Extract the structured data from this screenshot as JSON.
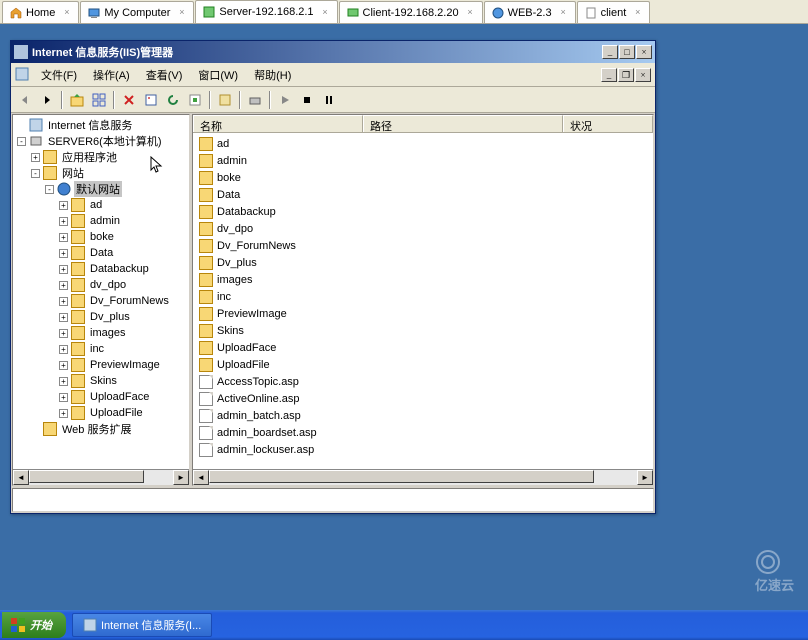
{
  "tabs": [
    {
      "label": "Home",
      "icon": "home"
    },
    {
      "label": "My Computer",
      "icon": "computer"
    },
    {
      "label": "Server-192.168.2.1",
      "icon": "server",
      "active": true
    },
    {
      "label": "Client-192.168.2.20",
      "icon": "client"
    },
    {
      "label": "WEB-2.3",
      "icon": "web"
    },
    {
      "label": "client",
      "icon": "doc"
    }
  ],
  "window": {
    "title": "Internet 信息服务(IIS)管理器",
    "menus": {
      "file": "文件(F)",
      "action": "操作(A)",
      "view": "查看(V)",
      "window": "窗口(W)",
      "help": "帮助(H)"
    }
  },
  "tree": {
    "root": "Internet 信息服务",
    "server": "SERVER6(本地计算机)",
    "apppool": "应用程序池",
    "sites": "网站",
    "defaultSite": "默认网站",
    "children": [
      "ad",
      "admin",
      "boke",
      "Data",
      "Databackup",
      "dv_dpo",
      "Dv_ForumNews",
      "Dv_plus",
      "images",
      "inc",
      "PreviewImage",
      "Skins",
      "UploadFace",
      "UploadFile"
    ],
    "ext": "Web 服务扩展"
  },
  "list": {
    "cols": {
      "name": "名称",
      "path": "路径",
      "status": "状况"
    },
    "folders": [
      "ad",
      "admin",
      "boke",
      "Data",
      "Databackup",
      "dv_dpo",
      "Dv_ForumNews",
      "Dv_plus",
      "images",
      "inc",
      "PreviewImage",
      "Skins",
      "UploadFace",
      "UploadFile"
    ],
    "files": [
      "AccessTopic.asp",
      "ActiveOnline.asp",
      "admin_batch.asp",
      "admin_boardset.asp",
      "admin_lockuser.asp"
    ]
  },
  "taskbar": {
    "start": "开始",
    "app": "Internet 信息服务(I..."
  },
  "watermark": "亿速云"
}
